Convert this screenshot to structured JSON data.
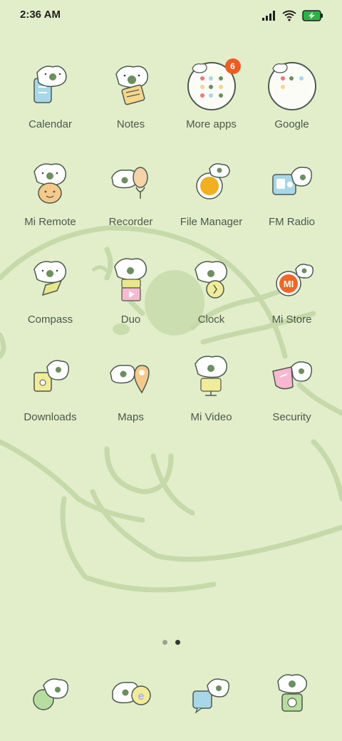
{
  "status_bar": {
    "time": "2:36 AM",
    "icons": [
      "signal-icon",
      "wifi-icon",
      "battery-charging-icon"
    ]
  },
  "apps": [
    [
      {
        "label": "Calendar",
        "icon": "calendar-icon"
      },
      {
        "label": "Notes",
        "icon": "notes-icon"
      },
      {
        "label": "More apps",
        "icon": "folder-icon",
        "badge": "6"
      },
      {
        "label": "Google",
        "icon": "folder-icon"
      }
    ],
    [
      {
        "label": "Mi Remote",
        "icon": "remote-icon"
      },
      {
        "label": "Recorder",
        "icon": "recorder-icon"
      },
      {
        "label": "File Manager",
        "icon": "file-manager-icon"
      },
      {
        "label": "FM Radio",
        "icon": "radio-icon"
      }
    ],
    [
      {
        "label": "Compass",
        "icon": "compass-icon"
      },
      {
        "label": "Duo",
        "icon": "duo-icon"
      },
      {
        "label": "Clock",
        "icon": "clock-icon"
      },
      {
        "label": "Mi Store",
        "icon": "mi-store-icon"
      }
    ],
    [
      {
        "label": "Downloads",
        "icon": "downloads-icon"
      },
      {
        "label": "Maps",
        "icon": "maps-icon"
      },
      {
        "label": "Mi Video",
        "icon": "video-icon"
      },
      {
        "label": "Security",
        "icon": "security-icon"
      }
    ]
  ],
  "page_indicator": {
    "pages": 2,
    "active": 1
  },
  "dock": [
    {
      "icon": "phone-icon"
    },
    {
      "icon": "browser-icon"
    },
    {
      "icon": "messaging-icon"
    },
    {
      "icon": "camera-icon"
    }
  ],
  "colors": {
    "background": "#e2edc9",
    "label": "#4c5a4f",
    "badge": "#f25a1e",
    "mascot_green": "#6b8f5e"
  }
}
